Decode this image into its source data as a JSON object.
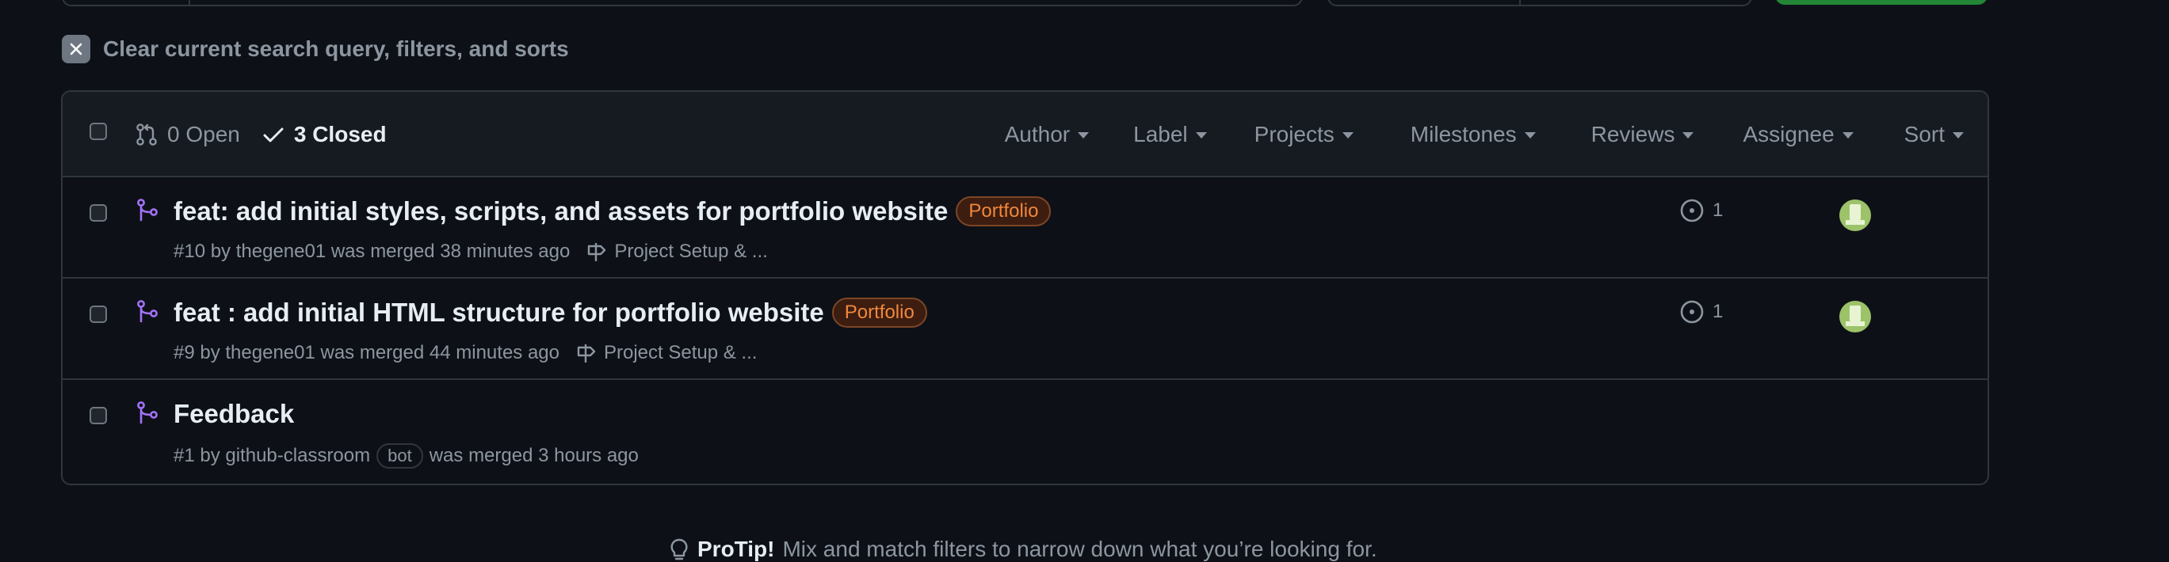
{
  "clear_filters": {
    "label": "Clear current search query, filters, and sorts"
  },
  "header": {
    "open_label": "0 Open",
    "closed_label": "3 Closed",
    "filters": [
      "Author",
      "Label",
      "Projects",
      "Milestones",
      "Reviews",
      "Assignee",
      "Sort"
    ]
  },
  "pull_requests": [
    {
      "title": "feat: add initial styles, scripts, and assets for portfolio website",
      "label": "Portfolio",
      "meta": "#10 by thegene01 was merged 38 minutes ago",
      "milestone": "Project Setup & ...",
      "linked_issues": "1",
      "has_assignee": true
    },
    {
      "title": "feat : add initial HTML structure for portfolio website",
      "label": "Portfolio",
      "meta": "#9 by thegene01 was merged 44 minutes ago",
      "milestone": "Project Setup & ...",
      "linked_issues": "1",
      "has_assignee": true
    },
    {
      "title": "Feedback",
      "meta_prefix": "#1 by github-classroom",
      "bot_badge": "bot",
      "meta_suffix": "was merged 3 hours ago"
    }
  ],
  "protip": {
    "bold": "ProTip!",
    "text": "Mix and match filters to narrow down what you’re looking for."
  },
  "colors": {
    "background": "#0d1117",
    "merged_purple": "#a371f7",
    "label_orange": "#f0883e",
    "primary_green": "#238636"
  },
  "icons": {
    "clear": "x-icon",
    "open": "git-pull-request-icon",
    "closed": "check-icon",
    "merged": "git-merge-icon",
    "milestone": "milestone-icon",
    "linked": "issue-opened-icon",
    "protip": "light-bulb-icon"
  }
}
